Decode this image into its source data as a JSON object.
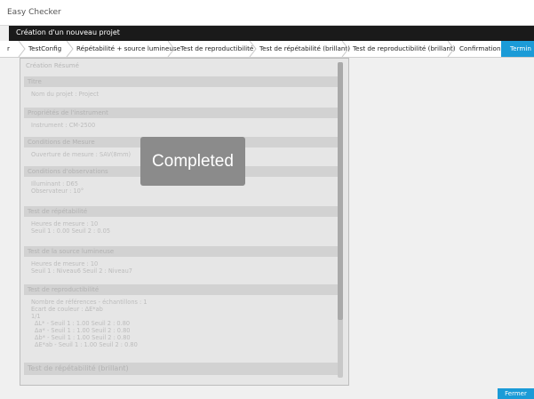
{
  "app": {
    "title": "Easy Checker"
  },
  "header": {
    "title": "Création d'un nouveau projet"
  },
  "steps": [
    {
      "label": "r"
    },
    {
      "label": "TestConfig"
    },
    {
      "label": "Répétabilité + source lumineuse"
    },
    {
      "label": "Test de reproductibilité"
    },
    {
      "label": "Test de répétabilité (brillant)"
    },
    {
      "label": "Test de reproductibilité (brillant)"
    },
    {
      "label": "Confirmation"
    },
    {
      "label": "Termin"
    }
  ],
  "summary": {
    "root": "Création Résumé",
    "sections": [
      {
        "title": "Titre",
        "lines": [
          "Nom du projet : Project"
        ]
      },
      {
        "title": "Propriétés de l'instrument",
        "lines": [
          "Instrument : CM-2500"
        ]
      },
      {
        "title": "Conditions de Mesure",
        "lines": [
          "Ouverture de mesure : SAV(8mm)"
        ]
      },
      {
        "title": "Conditions d'observations",
        "lines": [
          "Illuminant : D65",
          "Observateur : 10°"
        ]
      },
      {
        "title": "Test de répétabilité",
        "lines": [
          "Heures de mesure : 10",
          "Seuil 1 : 0.00  Seuil 2 : 0.05"
        ]
      },
      {
        "title": "Test de la source lumineuse",
        "lines": [
          "Heures de mesure : 10",
          "Seuil 1 : Niveau6  Seuil 2 : Niveau7"
        ]
      },
      {
        "title": "Test de reproductibilité",
        "lines": [
          "Nombre de références - échantillons : 1",
          "Ecart de couleur : ΔE*ab",
          "1/1",
          "ΔL* - Seuil 1 : 1.00  Seuil 2 : 0.80",
          "Δa* - Seuil 1 : 1.00  Seuil 2 : 0.80",
          "Δb* - Seuil 1 : 1.00  Seuil 2 : 0.80",
          "ΔE*ab - Seuil 1 : 1.00  Seuil 2 : 0.80"
        ]
      },
      {
        "title": "Test de répétabilité (brillant)",
        "lines": []
      }
    ]
  },
  "overlay": {
    "text": "Completed"
  },
  "footer": {
    "close_label": "Fermer"
  }
}
